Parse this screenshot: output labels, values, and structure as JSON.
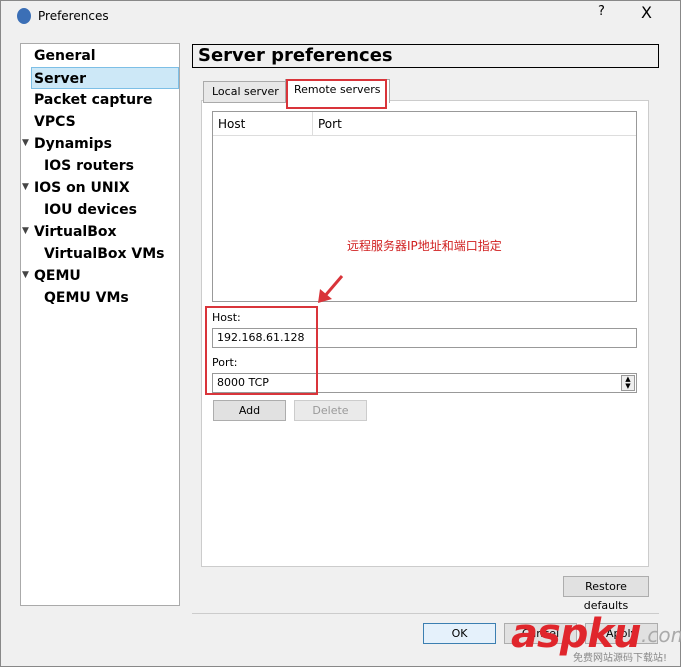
{
  "window": {
    "title": "Preferences",
    "help": "?",
    "close": "X"
  },
  "sidebar": {
    "items": [
      {
        "label": "General",
        "level": 0
      },
      {
        "label": "Server",
        "level": 0,
        "selected": true
      },
      {
        "label": "Packet capture",
        "level": 0
      },
      {
        "label": "VPCS",
        "level": 0
      },
      {
        "label": "Dynamips",
        "level": 0,
        "expanded": true
      },
      {
        "label": "IOS routers",
        "level": 1
      },
      {
        "label": "IOS on UNIX",
        "level": 0,
        "expanded": true
      },
      {
        "label": "IOU devices",
        "level": 1
      },
      {
        "label": "VirtualBox",
        "level": 0,
        "expanded": true
      },
      {
        "label": "VirtualBox VMs",
        "level": 1
      },
      {
        "label": "QEMU",
        "level": 0,
        "expanded": true
      },
      {
        "label": "QEMU VMs",
        "level": 1
      }
    ]
  },
  "page": {
    "title": "Server preferences",
    "tabs": [
      "Local server",
      "Remote servers"
    ],
    "columns": [
      "Host",
      "Port"
    ],
    "annotation": "远程服务器IP地址和端口指定",
    "host_label": "Host:",
    "host_value": "192.168.61.128",
    "port_label": "Port:",
    "port_value": "8000 TCP",
    "add": "Add",
    "delete": "Delete",
    "restore": "Restore defaults"
  },
  "footer": {
    "ok": "OK",
    "cancel": "Cancel",
    "apply": "Apply"
  },
  "watermark": {
    "brand": "aspku",
    ".com": ".com",
    "tagline": "免费网站源码下载站!"
  },
  "colors": {
    "highlight": "#d9343a",
    "selection": "#cde8f7"
  }
}
